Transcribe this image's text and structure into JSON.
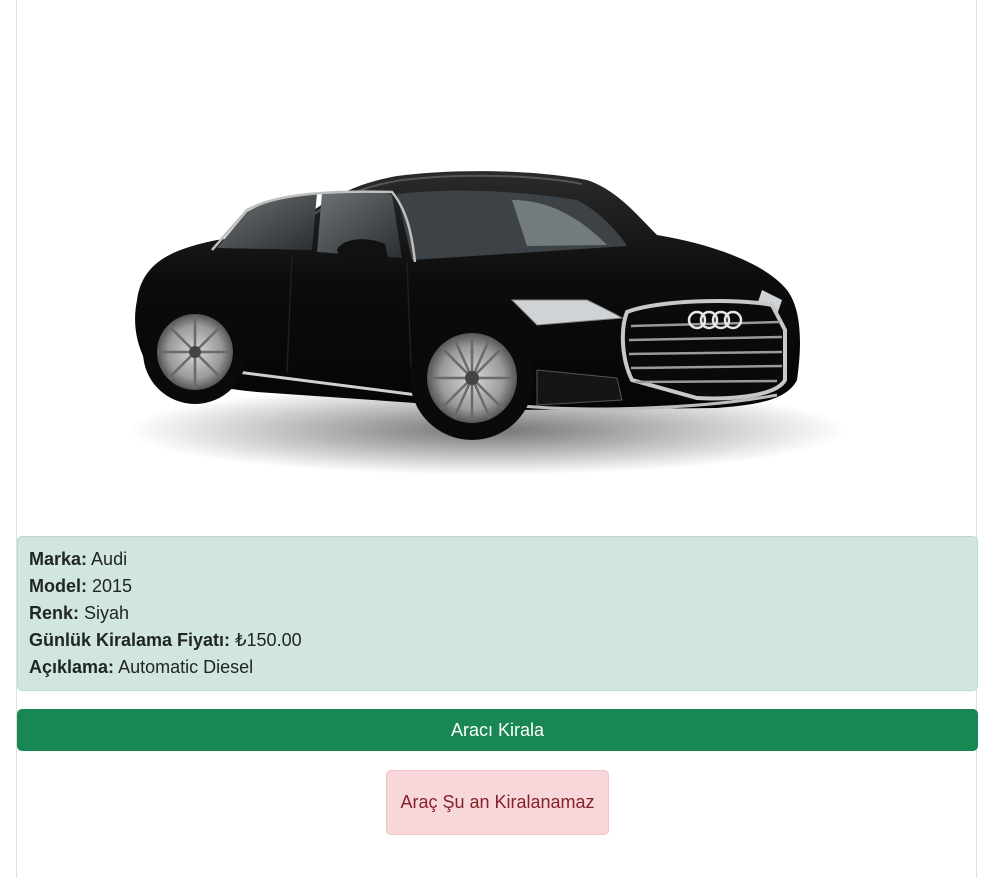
{
  "car": {
    "image_alt": "Audi",
    "fields": [
      {
        "label": "Marka:",
        "value": "Audi"
      },
      {
        "label": "Model:",
        "value": "2015"
      },
      {
        "label": "Renk:",
        "value": "Siyah"
      },
      {
        "label": "Günlük Kiralama Fiyatı:",
        "value": "₺150.00"
      },
      {
        "label": "Açıklama:",
        "value": "Automatic Diesel"
      }
    ]
  },
  "actions": {
    "rent_label": "Aracı Kirala"
  },
  "alert": {
    "unavailable_text": "Araç Şu an Kiralanamaz"
  },
  "colors": {
    "success": "#198754",
    "success_bg": "#d1e7dd",
    "danger_bg": "#f8d7da",
    "danger_text": "#842029"
  }
}
